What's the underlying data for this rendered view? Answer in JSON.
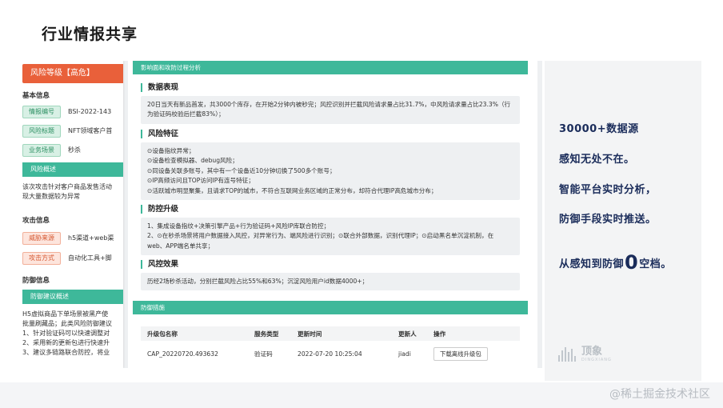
{
  "slide": {
    "title": "行业情报共享"
  },
  "left": {
    "risk_level": "风险等级【高危】",
    "basic_info": "基本信息",
    "fields": [
      {
        "label": "情报编号",
        "value": "BSI-2022-143"
      },
      {
        "label": "风险标题",
        "value": "NFT领域客户首"
      },
      {
        "label": "业务场景",
        "value": "秒杀"
      }
    ],
    "overview_head": "风险概述",
    "overview_lines": [
      "该次攻击针对客户商品发售活动",
      "现大量数据较为异常"
    ],
    "attack_info": "攻击信息",
    "attack_fields": [
      {
        "label": "威胁来源",
        "value": "h5渠道+web渠"
      },
      {
        "label": "攻击方式",
        "value": "自动化工具+脚"
      }
    ],
    "defense_info": "防御信息",
    "defense_head": "防御建议概述",
    "defense_lines": [
      "H5虚拟商品下单场景被黑产使",
      "批量刷藏品；此类风险防御建议",
      "1、针对验证码可以快速调整对",
      "2、采用新的更新包进行快速升",
      "3、建议多链路联合防控，将业"
    ]
  },
  "middle": {
    "impact_head": "影响面和攻防过程分析",
    "data_title": "数据表现",
    "data_lines": [
      "20日当天有新品首发，共3000个库存，在开始2分钟内被秒完；风控识别并拦截风险请求量占比31.7%，中风险请求量占比23.3%（行",
      "为验证码校验后拦截83%）；"
    ],
    "feature_title": "风险特征",
    "feature_lines": [
      "⊙设备指纹异常；",
      "⊙设备检查模拟器、debug风险；",
      "⊙同设备关联多账号，其中有一个设备近10分钟切换了500多个账号；",
      "⊙IP高频访问且TOP访问IP有连号特征；",
      "⊙活跃城市明显聚集，且请求TOP的城市，不符合互联网业务区域的正常分布，却符合代理IP高危城市分布；"
    ],
    "upgrade_title": "防控升级",
    "upgrade_lines": [
      "1、集成设备指纹+决策引擎产品+行为验证码+风险IP库联合防控；",
      "2、⊙在秒杀场景将用户数据接入风控，对异常行为、端风险进行识别；⊙联合外部数据，识别代理IP；⊙启动黑名单沉淀机制，在",
      "web、APP端名单共享；"
    ],
    "effect_title": "风控效果",
    "effect_lines": [
      "历经2场秒杀活动，分别拦截风险占比55%和63%；沉淀风险用户id数据4000+；"
    ],
    "defense_head": "防御措施",
    "table": {
      "headers": [
        "升级包名称",
        "服务类型",
        "更新时间",
        "更新人",
        "操作"
      ],
      "row": [
        "CAP_20220720.493632",
        "验证码",
        "2022-07-20 10:25:04",
        "jiadi",
        "下载离线升级包"
      ]
    }
  },
  "right": {
    "line1_num": "30000",
    "line1_rest": "+数据源",
    "line2": "感知无处不在。",
    "line3": "智能平台实时分析，",
    "line4": "防御手段实时推送。",
    "line5_pre": "从感知到防御",
    "line5_num": "0",
    "line5_post": "空档。",
    "brand_name": "顶象",
    "brand_sub": "DINGXIANG"
  },
  "watermark": "@稀土掘金技术社区",
  "colors": {
    "accent_green": "#3eb89a",
    "risk_orange": "#e9603a",
    "navy_text": "#1a2c5a"
  }
}
